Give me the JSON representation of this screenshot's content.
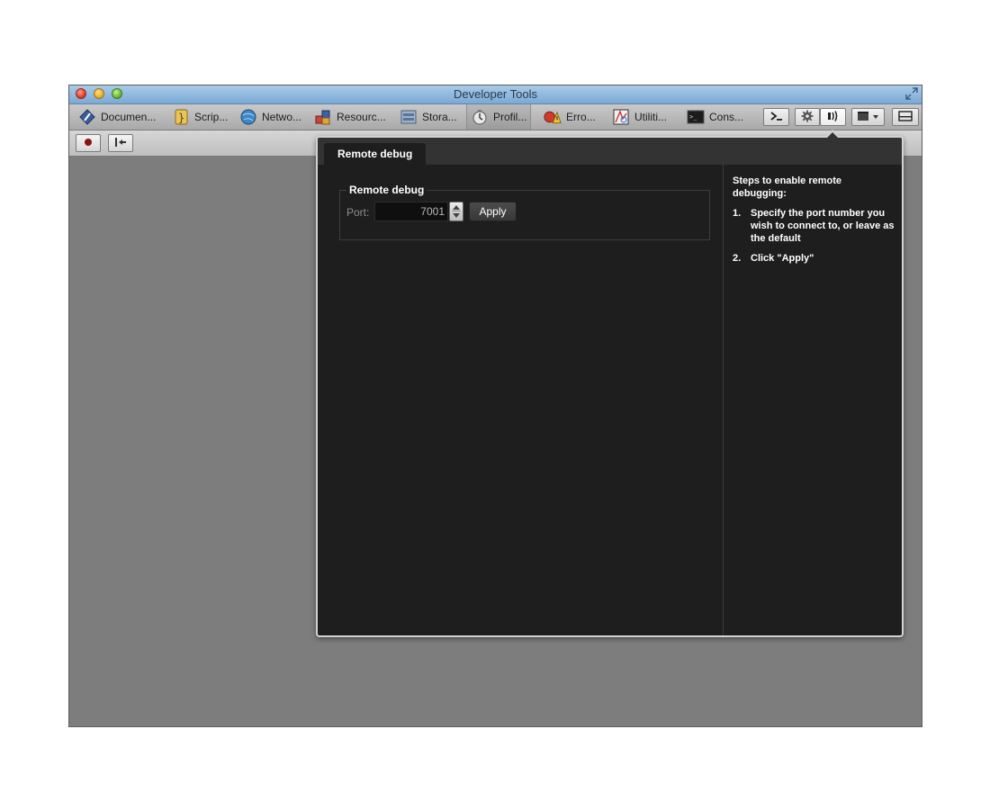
{
  "window": {
    "title": "Developer Tools"
  },
  "toolbar": {
    "tabs": [
      {
        "label": "Documen...",
        "icon": "documents-icon"
      },
      {
        "label": "Scrip...",
        "icon": "scripts-icon"
      },
      {
        "label": "Netwo...",
        "icon": "network-icon"
      },
      {
        "label": "Resourc...",
        "icon": "resources-icon"
      },
      {
        "label": "Stora...",
        "icon": "storage-icon"
      },
      {
        "label": "Profil...",
        "icon": "profiler-icon"
      },
      {
        "label": "Erro...",
        "icon": "errors-icon"
      },
      {
        "label": "Utiliti...",
        "icon": "utilities-icon"
      },
      {
        "label": "Cons...",
        "icon": "console-icon"
      }
    ],
    "right_buttons": [
      "command-line-icon",
      "settings-icon",
      "remote-debug-icon",
      "window-menu-icon",
      "dock-icon"
    ]
  },
  "subbar": {
    "buttons": [
      "record-icon",
      "pick-element-icon"
    ]
  },
  "popover": {
    "tab_label": "Remote debug",
    "group_title": "Remote debug",
    "port_label": "Port:",
    "port_value": "7001",
    "apply_label": "Apply",
    "side_heading": "Steps to enable remote debugging:",
    "steps": [
      {
        "num": "1.",
        "text": "Specify the port number you wish to connect to, or leave as the default"
      },
      {
        "num": "2.",
        "text": "Click \"Apply\""
      }
    ]
  }
}
